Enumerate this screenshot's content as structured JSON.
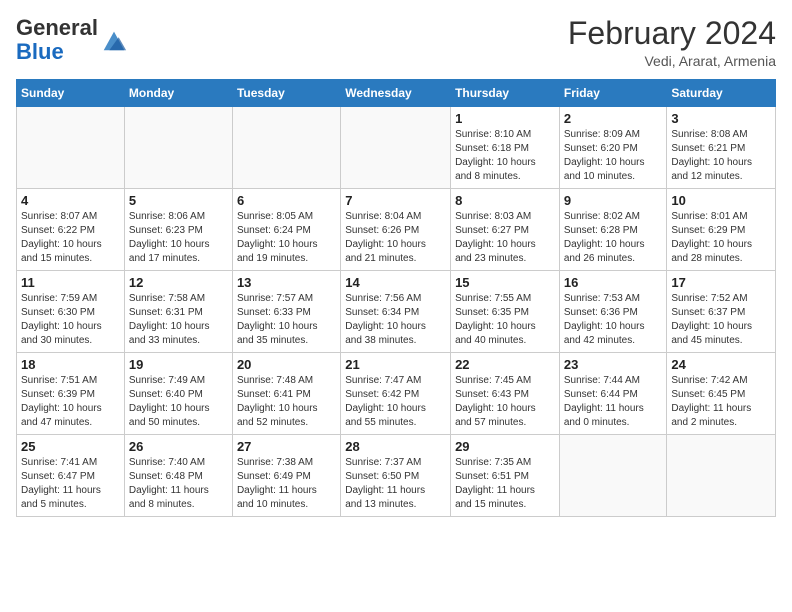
{
  "header": {
    "logo_general": "General",
    "logo_blue": "Blue",
    "month_year": "February 2024",
    "location": "Vedi, Ararat, Armenia"
  },
  "weekdays": [
    "Sunday",
    "Monday",
    "Tuesday",
    "Wednesday",
    "Thursday",
    "Friday",
    "Saturday"
  ],
  "weeks": [
    [
      {
        "day": "",
        "info": ""
      },
      {
        "day": "",
        "info": ""
      },
      {
        "day": "",
        "info": ""
      },
      {
        "day": "",
        "info": ""
      },
      {
        "day": "1",
        "info": "Sunrise: 8:10 AM\nSunset: 6:18 PM\nDaylight: 10 hours\nand 8 minutes."
      },
      {
        "day": "2",
        "info": "Sunrise: 8:09 AM\nSunset: 6:20 PM\nDaylight: 10 hours\nand 10 minutes."
      },
      {
        "day": "3",
        "info": "Sunrise: 8:08 AM\nSunset: 6:21 PM\nDaylight: 10 hours\nand 12 minutes."
      }
    ],
    [
      {
        "day": "4",
        "info": "Sunrise: 8:07 AM\nSunset: 6:22 PM\nDaylight: 10 hours\nand 15 minutes."
      },
      {
        "day": "5",
        "info": "Sunrise: 8:06 AM\nSunset: 6:23 PM\nDaylight: 10 hours\nand 17 minutes."
      },
      {
        "day": "6",
        "info": "Sunrise: 8:05 AM\nSunset: 6:24 PM\nDaylight: 10 hours\nand 19 minutes."
      },
      {
        "day": "7",
        "info": "Sunrise: 8:04 AM\nSunset: 6:26 PM\nDaylight: 10 hours\nand 21 minutes."
      },
      {
        "day": "8",
        "info": "Sunrise: 8:03 AM\nSunset: 6:27 PM\nDaylight: 10 hours\nand 23 minutes."
      },
      {
        "day": "9",
        "info": "Sunrise: 8:02 AM\nSunset: 6:28 PM\nDaylight: 10 hours\nand 26 minutes."
      },
      {
        "day": "10",
        "info": "Sunrise: 8:01 AM\nSunset: 6:29 PM\nDaylight: 10 hours\nand 28 minutes."
      }
    ],
    [
      {
        "day": "11",
        "info": "Sunrise: 7:59 AM\nSunset: 6:30 PM\nDaylight: 10 hours\nand 30 minutes."
      },
      {
        "day": "12",
        "info": "Sunrise: 7:58 AM\nSunset: 6:31 PM\nDaylight: 10 hours\nand 33 minutes."
      },
      {
        "day": "13",
        "info": "Sunrise: 7:57 AM\nSunset: 6:33 PM\nDaylight: 10 hours\nand 35 minutes."
      },
      {
        "day": "14",
        "info": "Sunrise: 7:56 AM\nSunset: 6:34 PM\nDaylight: 10 hours\nand 38 minutes."
      },
      {
        "day": "15",
        "info": "Sunrise: 7:55 AM\nSunset: 6:35 PM\nDaylight: 10 hours\nand 40 minutes."
      },
      {
        "day": "16",
        "info": "Sunrise: 7:53 AM\nSunset: 6:36 PM\nDaylight: 10 hours\nand 42 minutes."
      },
      {
        "day": "17",
        "info": "Sunrise: 7:52 AM\nSunset: 6:37 PM\nDaylight: 10 hours\nand 45 minutes."
      }
    ],
    [
      {
        "day": "18",
        "info": "Sunrise: 7:51 AM\nSunset: 6:39 PM\nDaylight: 10 hours\nand 47 minutes."
      },
      {
        "day": "19",
        "info": "Sunrise: 7:49 AM\nSunset: 6:40 PM\nDaylight: 10 hours\nand 50 minutes."
      },
      {
        "day": "20",
        "info": "Sunrise: 7:48 AM\nSunset: 6:41 PM\nDaylight: 10 hours\nand 52 minutes."
      },
      {
        "day": "21",
        "info": "Sunrise: 7:47 AM\nSunset: 6:42 PM\nDaylight: 10 hours\nand 55 minutes."
      },
      {
        "day": "22",
        "info": "Sunrise: 7:45 AM\nSunset: 6:43 PM\nDaylight: 10 hours\nand 57 minutes."
      },
      {
        "day": "23",
        "info": "Sunrise: 7:44 AM\nSunset: 6:44 PM\nDaylight: 11 hours\nand 0 minutes."
      },
      {
        "day": "24",
        "info": "Sunrise: 7:42 AM\nSunset: 6:45 PM\nDaylight: 11 hours\nand 2 minutes."
      }
    ],
    [
      {
        "day": "25",
        "info": "Sunrise: 7:41 AM\nSunset: 6:47 PM\nDaylight: 11 hours\nand 5 minutes."
      },
      {
        "day": "26",
        "info": "Sunrise: 7:40 AM\nSunset: 6:48 PM\nDaylight: 11 hours\nand 8 minutes."
      },
      {
        "day": "27",
        "info": "Sunrise: 7:38 AM\nSunset: 6:49 PM\nDaylight: 11 hours\nand 10 minutes."
      },
      {
        "day": "28",
        "info": "Sunrise: 7:37 AM\nSunset: 6:50 PM\nDaylight: 11 hours\nand 13 minutes."
      },
      {
        "day": "29",
        "info": "Sunrise: 7:35 AM\nSunset: 6:51 PM\nDaylight: 11 hours\nand 15 minutes."
      },
      {
        "day": "",
        "info": ""
      },
      {
        "day": "",
        "info": ""
      }
    ]
  ]
}
